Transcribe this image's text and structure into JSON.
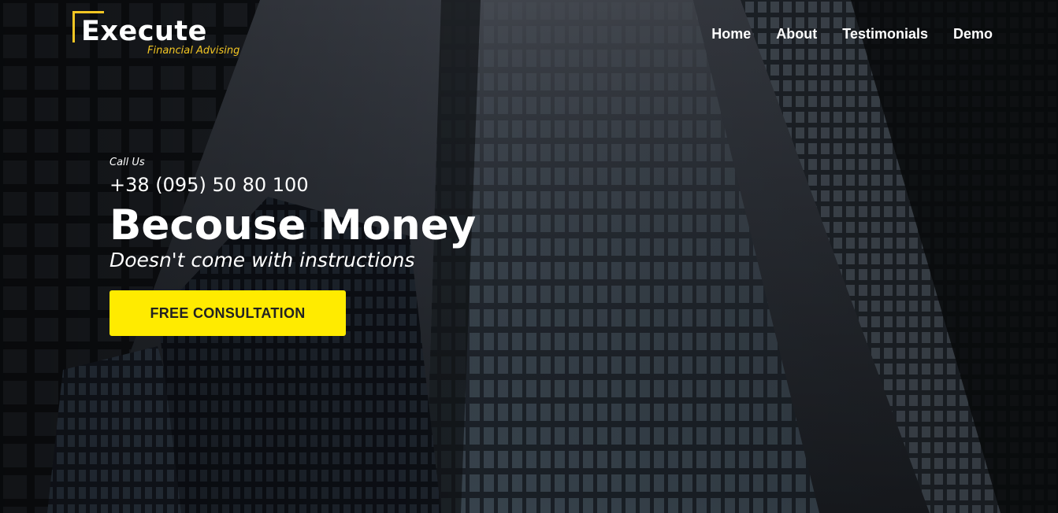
{
  "brand": {
    "name": "Execute",
    "tagline": "Financial Advising",
    "accent_color": "#f3c623"
  },
  "nav": {
    "items": [
      {
        "label": "Home"
      },
      {
        "label": "About"
      },
      {
        "label": "Testimonials"
      },
      {
        "label": "Demo"
      }
    ]
  },
  "hero": {
    "call_label": "Call Us",
    "phone": "+38 (095) 50 80 100",
    "headline": "Becouse Money",
    "subline": "Doesn't come with instructions",
    "cta_label": "FREE CONSULTATION",
    "cta_color": "#ffeb00",
    "background_image": "dark-skyscrapers-photo"
  }
}
